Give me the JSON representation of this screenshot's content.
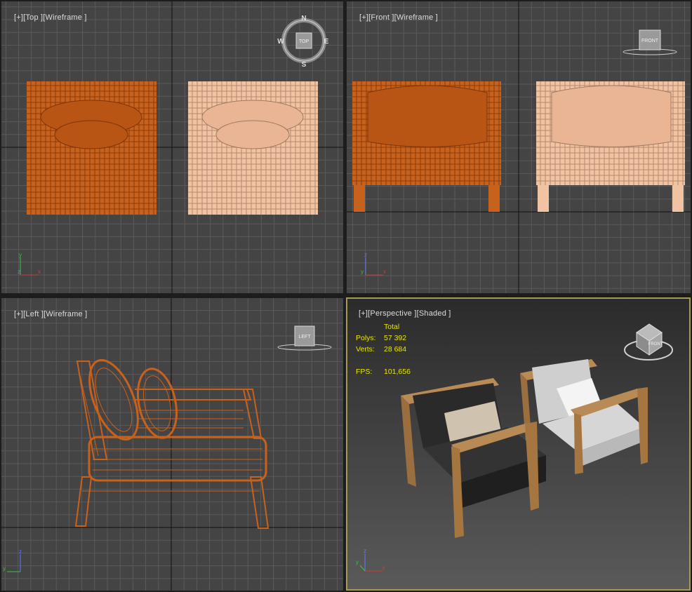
{
  "viewports": {
    "top": {
      "plus": "[+]",
      "view": "[Top ]",
      "mode": "[Wireframe ]"
    },
    "front": {
      "plus": "[+]",
      "view": "[Front ]",
      "mode": "[Wireframe ]"
    },
    "left": {
      "plus": "[+]",
      "view": "[Left ]",
      "mode": "[Wireframe ]"
    },
    "persp": {
      "plus": "[+]",
      "view": "[Perspective ]",
      "mode": "[Shaded ]"
    }
  },
  "compass": {
    "n": "N",
    "s": "S",
    "e": "E",
    "w": "W",
    "cube": "TOP"
  },
  "viewcube": {
    "front": "FRONT",
    "left": "LEFT",
    "persp_front": "FRONT"
  },
  "axes": {
    "x": "x",
    "y": "y",
    "z": "z"
  },
  "stats": {
    "header": "Total",
    "polys_label": "Polys:",
    "polys": "57 392",
    "verts_label": "Verts:",
    "verts": "28 684",
    "fps_label": "FPS:",
    "fps": "101,656"
  },
  "colors": {
    "viewport_bg": "#444444",
    "grid": "#5a5a5a",
    "grid_major": "#111111",
    "wire_orange": "#c8611c",
    "wire_peach": "#f2c3a2",
    "active_border": "#a89a4e",
    "stats_text": "#e8e600"
  }
}
